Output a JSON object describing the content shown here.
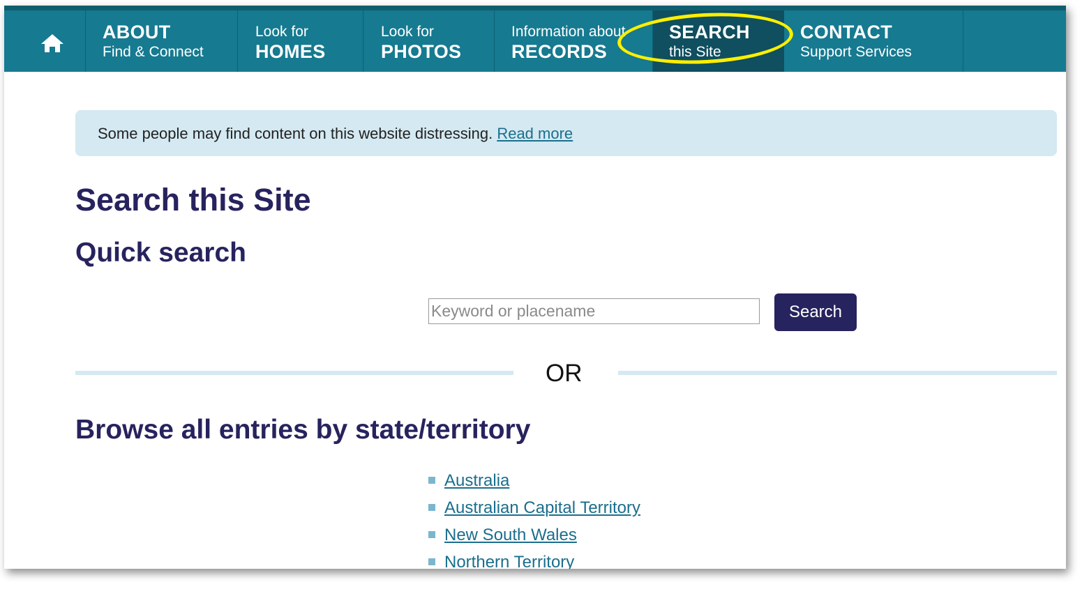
{
  "nav": {
    "home_icon": "home-icon",
    "items": [
      {
        "small": "Find & Connect",
        "big": "ABOUT"
      },
      {
        "small": "Look for",
        "big": "HOMES"
      },
      {
        "small": "Look for",
        "big": "PHOTOS"
      },
      {
        "small": "Information about",
        "big": "RECORDS"
      },
      {
        "small": "this Site",
        "big": "SEARCH"
      },
      {
        "small": "Support Services",
        "big": "CONTACT"
      }
    ]
  },
  "notice": {
    "text": "Some people may find content on this website distressing.",
    "link": "Read more"
  },
  "page_title": "Search this Site",
  "quick_search": {
    "heading": "Quick search",
    "placeholder": "Keyword or placename",
    "button": "Search"
  },
  "divider_text": "OR",
  "browse": {
    "heading": "Browse all entries by state/territory",
    "states": [
      "Australia",
      "Australian Capital Territory",
      "New South Wales",
      "Northern Territory"
    ]
  },
  "colors": {
    "nav_bg": "#167a90",
    "nav_active": "#0f4f5f",
    "heading": "#27235e",
    "link": "#1b6e8d",
    "notice_bg": "#d4e9f1",
    "highlight": "#ffef00"
  }
}
